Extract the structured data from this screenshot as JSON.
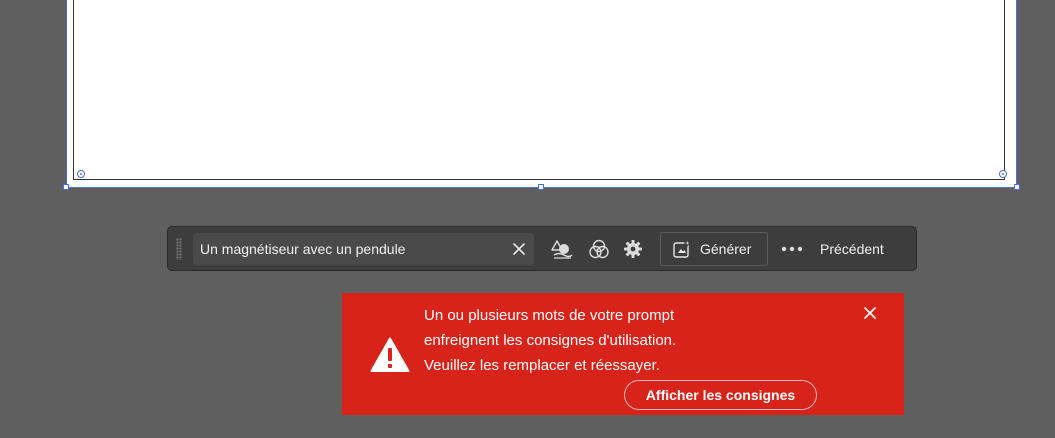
{
  "canvas": {
    "frame_color": "#4b6fd6",
    "artboard_color": "#ffffff"
  },
  "taskbar": {
    "prompt_value": "Un magnétiseur avec un pendule",
    "generate_label": "Générer",
    "previous_label": "Précédent",
    "icons": [
      "drag-grip-icon",
      "clear-icon",
      "shapes-style-icon",
      "color-circles-icon",
      "settings-gear-icon",
      "generate-sparkle-icon",
      "more-dots-icon"
    ]
  },
  "toast": {
    "background": "#d7231a",
    "message_lines": [
      "Un ou plusieurs mots de votre prompt",
      "enfreignent les consignes d'utilisation.",
      "Veuillez les remplacer et réessayer."
    ],
    "action_label": "Afficher les consignes",
    "icons": [
      "warning-icon",
      "close-icon"
    ]
  }
}
